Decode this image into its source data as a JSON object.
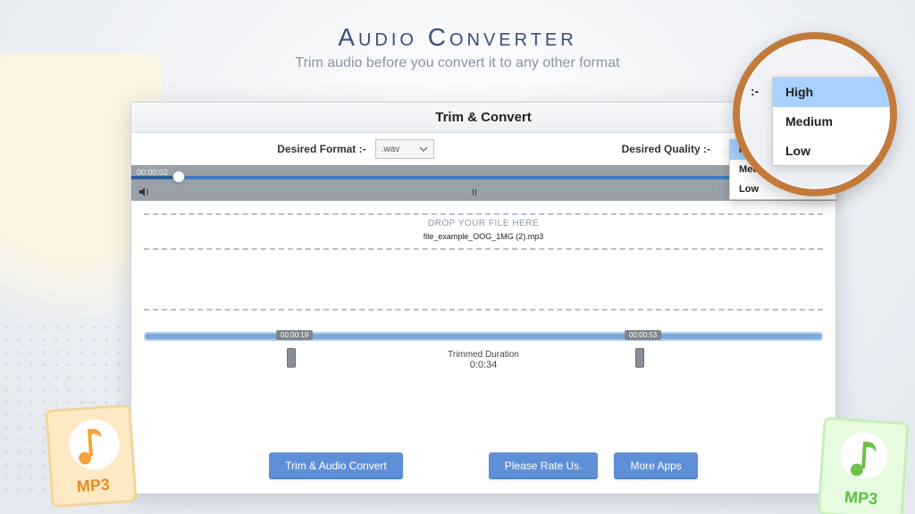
{
  "header": {
    "title": "Audio Converter",
    "subtitle": "Trim audio before you convert it to any other format"
  },
  "window": {
    "title": "Trim & Convert",
    "format_label": "Desired Format :-",
    "format_value": ".wav",
    "quality_label": "Desired Quality :-"
  },
  "player": {
    "time_left": "00:00:02",
    "pause_glyph": "II"
  },
  "dropzone": {
    "prompt": "DROP YOUR FILE HERE",
    "filename": "file_example_OOG_1MG (2).mp3"
  },
  "trim": {
    "start_flag": "00:00:19",
    "end_flag": "00:00:53",
    "duration_label": "Trimmed Duration",
    "duration_value": "0:0:34"
  },
  "buttons": {
    "trim_convert": "Trim & Audio Convert",
    "rate": "Please Rate Us.",
    "more": "More Apps"
  },
  "quality": {
    "options": [
      "High",
      "Medium",
      "Low"
    ],
    "selected": "High",
    "lens_label": ":-"
  },
  "badges": {
    "mp3": "MP3"
  }
}
